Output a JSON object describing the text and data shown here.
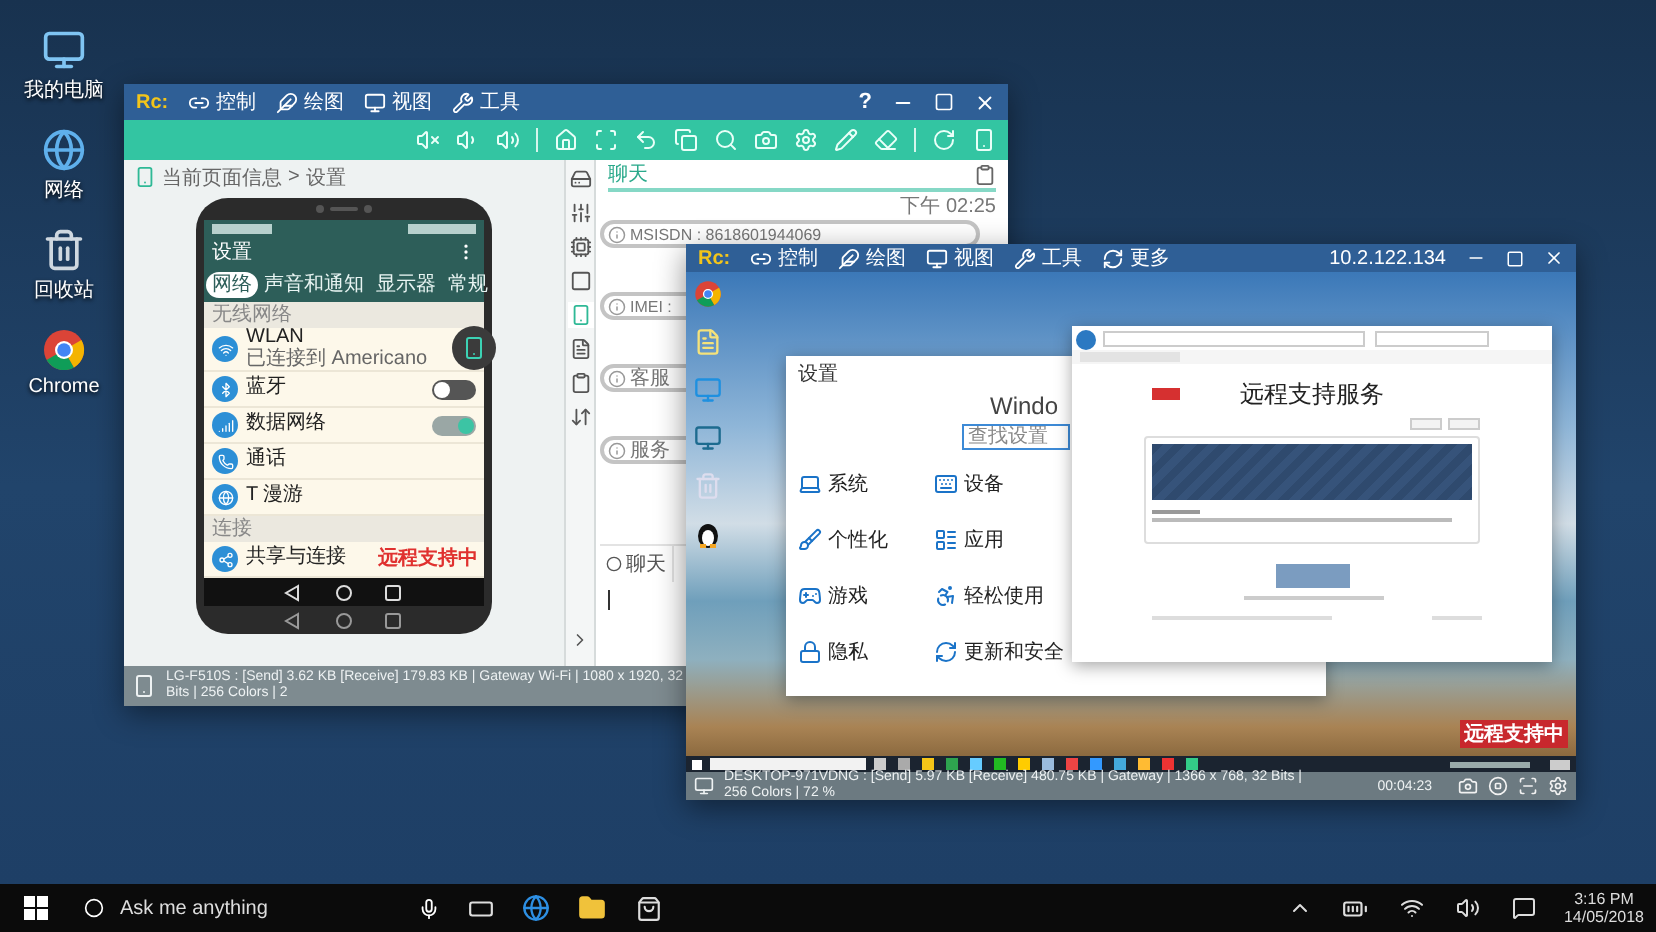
{
  "desktop_icons": [
    {
      "label": "我的电脑"
    },
    {
      "label": "网络"
    },
    {
      "label": "回收站"
    },
    {
      "label": "Chrome"
    }
  ],
  "mobile_window": {
    "logo": "Rc:",
    "help": "?",
    "menu": [
      {
        "label": "控制",
        "kind": "control"
      },
      {
        "label": "绘图",
        "kind": "draw"
      },
      {
        "label": "视图",
        "kind": "view"
      },
      {
        "label": "工具",
        "kind": "tools"
      }
    ],
    "breadcrumb": [
      "当前页面信息",
      ">",
      "设置"
    ],
    "phone": {
      "title": "设置",
      "badge": "远程支持中",
      "tabs": [
        {
          "label": "网络",
          "selected": true
        },
        {
          "label": "声音和通知",
          "selected": false
        },
        {
          "label": "显示器",
          "selected": false
        },
        {
          "label": "常规",
          "selected": false
        }
      ],
      "sections": [
        {
          "title": "无线网络",
          "items": [
            {
              "title": "WLAN",
              "subtitle": "已连接到 Americano",
              "kind": "pointer"
            },
            {
              "title": "蓝牙",
              "kind": "switch",
              "on": false
            },
            {
              "title": "数据网络",
              "kind": "switch",
              "on": true
            },
            {
              "title": "通话",
              "kind": "plain"
            },
            {
              "title": "T 漫游",
              "kind": "plain"
            }
          ]
        },
        {
          "title": "连接",
          "items": [
            {
              "title": "共享与连接",
              "kind": "plain"
            }
          ]
        }
      ]
    },
    "side_tools": [
      {
        "selected": false
      },
      {
        "selected": false
      },
      {
        "selected": false
      },
      {
        "selected": false
      },
      {
        "selected": true
      },
      {
        "selected": false
      },
      {
        "selected": false
      },
      {
        "selected": false
      }
    ],
    "chat": {
      "title": "聊天",
      "time": "下午 02:25",
      "info": [
        "MSISDN : 8618601944069",
        "IMEI :",
        "客服",
        "服务"
      ],
      "tabs": [
        {
          "label": "聊天",
          "selected": true
        }
      ]
    },
    "status": "LG-F510S : [Send] 3.62 KB  [Receive] 179.83 KB | Gateway Wi-Fi | 1080 x 1920, 32 Bits | 256 Colors | 2"
  },
  "remote_window": {
    "logo": "Rc:",
    "address": "10.2.122.134",
    "menu": [
      {
        "label": "控制",
        "kind": "control"
      },
      {
        "label": "绘图",
        "kind": "draw"
      },
      {
        "label": "视图",
        "kind": "view"
      },
      {
        "label": "工具",
        "kind": "tools"
      },
      {
        "label": "更多",
        "kind": "more"
      }
    ],
    "settings_window": {
      "title": "设置",
      "heading": "Windo",
      "search_placeholder": "查找设置",
      "items": [
        "系统",
        "设备",
        "个性化",
        "应用",
        "游戏",
        "轻松使用",
        "隐私",
        "更新和安全"
      ]
    },
    "browser": {
      "title": "远程支持服务"
    },
    "badge": "远程支持中",
    "status": "DESKTOP-971VDNG : [Send] 5.97 KB  [Receive] 480.75 KB | Gateway | 1366 x 768, 32 Bits | 256 Colors | 72 %",
    "timer": "00:04:23"
  },
  "taskbar": {
    "search_placeholder": "Ask me anything",
    "time": "3:16 PM",
    "date": "14/05/2018"
  }
}
